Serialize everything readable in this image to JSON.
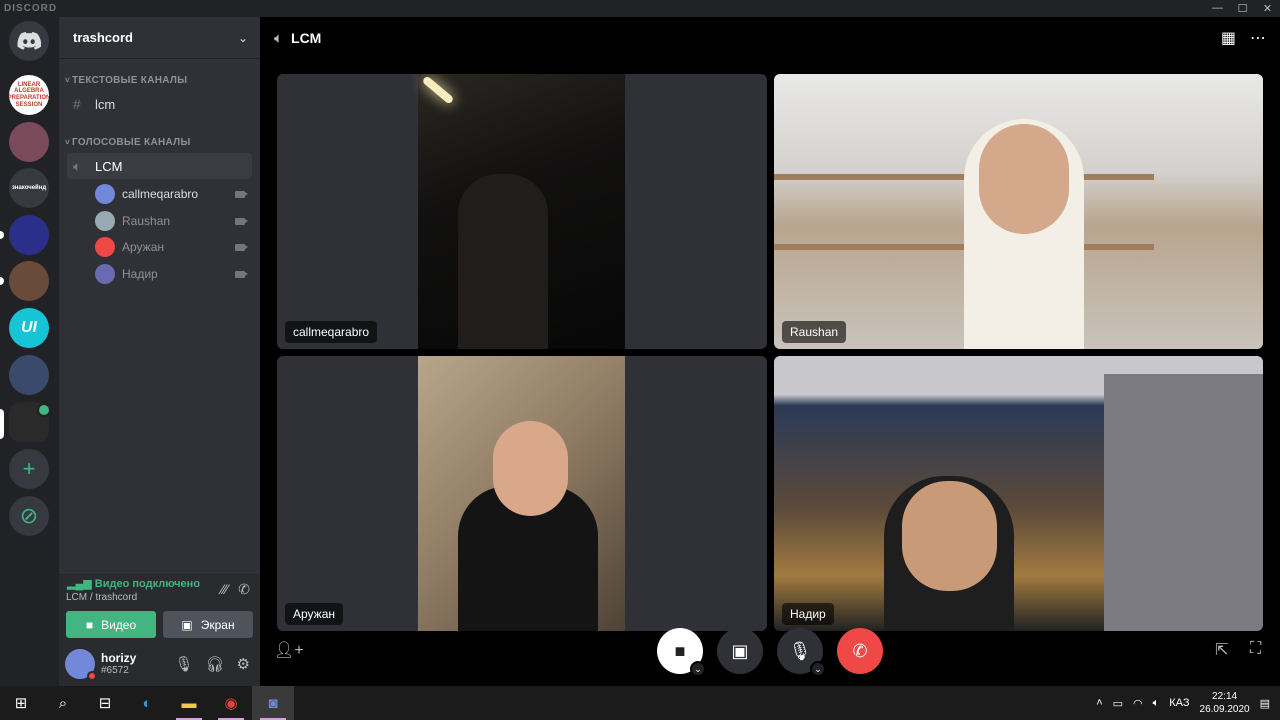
{
  "titlebar": {
    "brand": "DISCORD",
    "min": "—",
    "max": "☐",
    "close": "✕"
  },
  "servers": [
    {
      "text": "LINEAR ALGEBRA PREPARATION SESSION",
      "bg": "#ffffff",
      "fg": "#c0392b"
    },
    {
      "text": "",
      "bg": "#7a4a5a"
    },
    {
      "text": "знакочейнд",
      "bg": "#36393f"
    },
    {
      "text": "",
      "bg": "#2a2f8a"
    },
    {
      "text": "",
      "bg": "#6a4a3a"
    },
    {
      "text": "UI",
      "bg": "#16c4d6"
    },
    {
      "text": "",
      "bg": "#3a4a6a"
    },
    {
      "text": "",
      "bg": "#2a2a2a"
    }
  ],
  "guild": {
    "name": "trashcord"
  },
  "categories": {
    "text": "ТЕКСТОВЫЕ КАНАЛЫ",
    "voice": "ГОЛОСОВЫЕ КАНАЛЫ"
  },
  "text_channel": {
    "name": "lcm"
  },
  "voice_channel": {
    "name": "LCM"
  },
  "voice_users": [
    {
      "name": "callmeqarabro",
      "color": "#7289da"
    },
    {
      "name": "Raushan",
      "color": "#99aab5"
    },
    {
      "name": "Аружан",
      "color": "#f04747"
    },
    {
      "name": "Надир",
      "color": "#6a6ab0"
    }
  ],
  "voice_panel": {
    "status": "Видео подключено",
    "location": "LCM / trashcord",
    "video_label": "Видео",
    "screen_label": "Экран"
  },
  "user": {
    "name": "horizy",
    "tag": "#6572"
  },
  "main": {
    "channel": "LCM"
  },
  "tiles": [
    {
      "label": "callmeqarabro"
    },
    {
      "label": "Raushan"
    },
    {
      "label": "Аружан"
    },
    {
      "label": "Надир"
    }
  ],
  "taskbar": {
    "lang": "КАЗ",
    "time": "22:14",
    "date": "26.09.2020"
  }
}
